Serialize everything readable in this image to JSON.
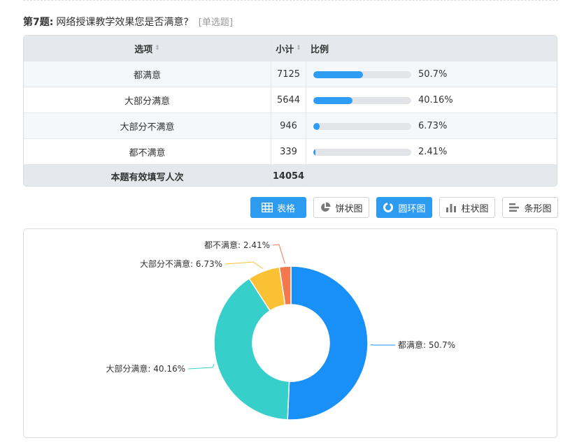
{
  "question": {
    "number": "第7题:",
    "text": "网络授课教学效果您是否满意?",
    "type": "[单选题]"
  },
  "table": {
    "headers": {
      "option": "选项",
      "count": "小计",
      "ratio": "比例",
      "sort_icon": "⇕"
    },
    "rows": [
      {
        "option": "都满意",
        "count": "7125",
        "percent": "50.7%",
        "fraction": 0.507
      },
      {
        "option": "大部分满意",
        "count": "5644",
        "percent": "40.16%",
        "fraction": 0.4016
      },
      {
        "option": "大部分不满意",
        "count": "946",
        "percent": "6.73%",
        "fraction": 0.0673
      },
      {
        "option": "都不满意",
        "count": "339",
        "percent": "2.41%",
        "fraction": 0.0241
      }
    ],
    "footer": {
      "label": "本题有效填写人次",
      "total": "14054"
    }
  },
  "toolbar": {
    "buttons": [
      {
        "label": "表格",
        "icon": "table-icon",
        "active": true
      },
      {
        "label": "饼状图",
        "icon": "pie-chart-icon",
        "active": false
      },
      {
        "label": "圆环图",
        "icon": "donut-chart-icon",
        "active": true
      },
      {
        "label": "柱状图",
        "icon": "bar-chart-icon",
        "active": false
      },
      {
        "label": "条形图",
        "icon": "horizontal-bar-icon",
        "active": false
      }
    ]
  },
  "colors": {
    "accent": "#2c9bf0",
    "bar": "#2d9df3",
    "slice_1": "#1890f8",
    "slice_2": "#36cfc9",
    "slice_3": "#fbc134",
    "slice_4": "#f4784e"
  },
  "chart_data": {
    "type": "pie",
    "style": "donut",
    "categories": [
      "都满意",
      "大部分满意",
      "大部分不满意",
      "都不满意"
    ],
    "values": [
      50.7,
      40.16,
      6.73,
      2.41
    ],
    "labels": [
      "都满意: 50.7%",
      "大部分满意: 40.16%",
      "大部分不满意: 6.73%",
      "都不满意: 2.41%"
    ]
  }
}
